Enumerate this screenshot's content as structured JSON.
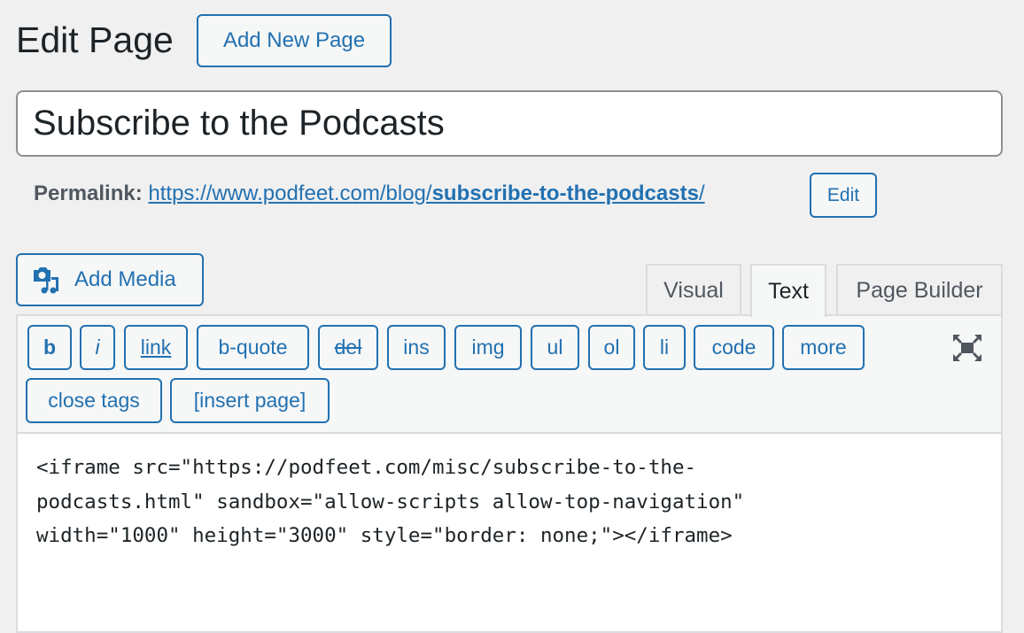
{
  "header": {
    "title": "Edit Page",
    "add_new_label": "Add New Page"
  },
  "post_title": "Subscribe to the Podcasts",
  "permalink": {
    "label": "Permalink:",
    "base": "https://www.podfeet.com/blog/",
    "slug": "subscribe-to-the-podcasts",
    "trail": "/",
    "edit_label": "Edit"
  },
  "media": {
    "add_media_label": "Add Media",
    "icon": "camera-music-icon"
  },
  "tabs": [
    {
      "label": "Visual"
    },
    {
      "label": "Text",
      "active": true
    },
    {
      "label": "Page Builder"
    }
  ],
  "quicktags": [
    "b",
    "i",
    "link",
    "b-quote",
    "del",
    "ins",
    "img",
    "ul",
    "ol",
    "li",
    "code",
    "more",
    "close tags",
    "[insert page]"
  ],
  "fullscreen_icon": "expand-icon",
  "content": "<iframe src=\"https://podfeet.com/misc/subscribe-to-the-\npodcasts.html\" sandbox=\"allow-scripts allow-top-navigation\"\nwidth=\"1000\" height=\"3000\" style=\"border: none;\"></iframe>",
  "colors": {
    "accent": "#2271b1",
    "background": "#f0f0f1"
  }
}
